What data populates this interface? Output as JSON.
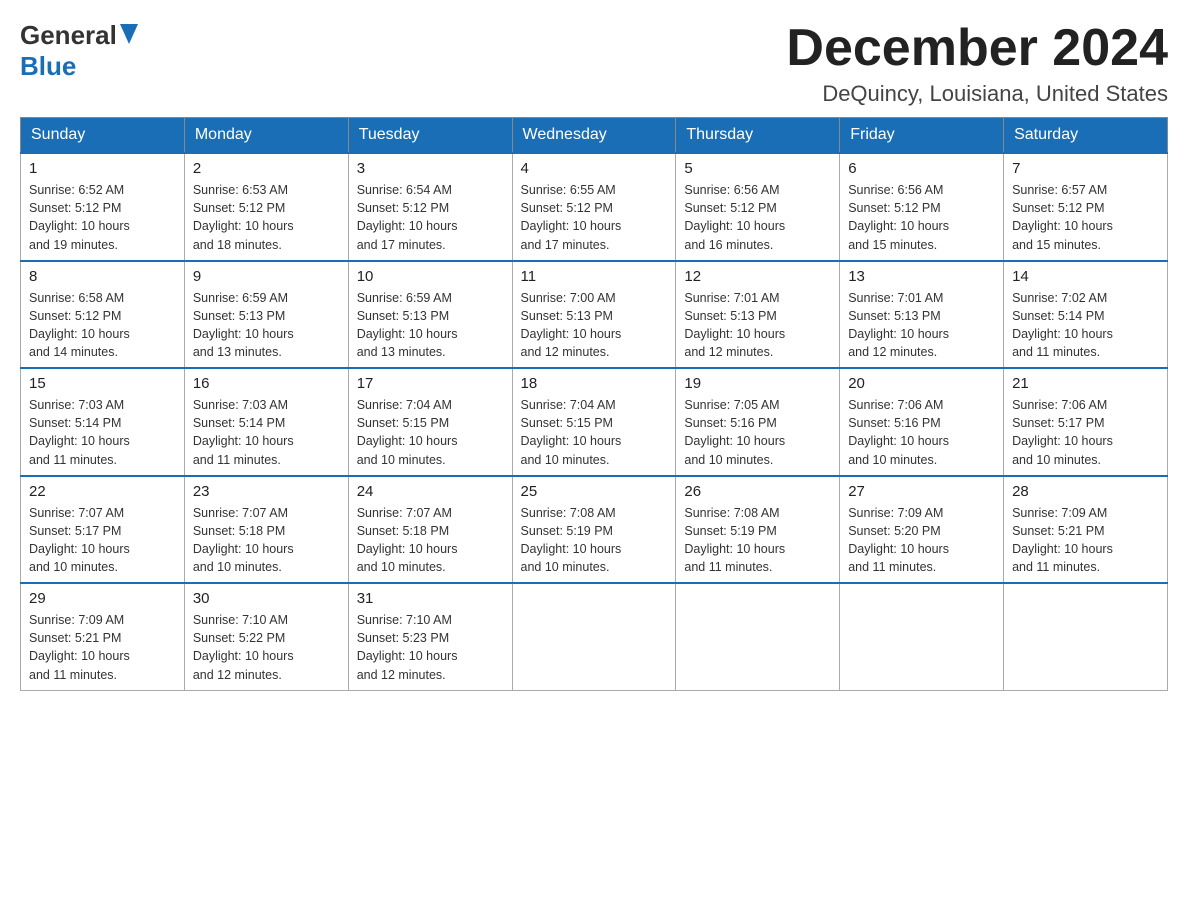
{
  "header": {
    "logo_line1": "General",
    "logo_line2": "Blue",
    "month_title": "December 2024",
    "location": "DeQuincy, Louisiana, United States"
  },
  "days_of_week": [
    "Sunday",
    "Monday",
    "Tuesday",
    "Wednesday",
    "Thursday",
    "Friday",
    "Saturday"
  ],
  "weeks": [
    [
      {
        "day": "1",
        "sunrise": "6:52 AM",
        "sunset": "5:12 PM",
        "daylight": "10 hours and 19 minutes."
      },
      {
        "day": "2",
        "sunrise": "6:53 AM",
        "sunset": "5:12 PM",
        "daylight": "10 hours and 18 minutes."
      },
      {
        "day": "3",
        "sunrise": "6:54 AM",
        "sunset": "5:12 PM",
        "daylight": "10 hours and 17 minutes."
      },
      {
        "day": "4",
        "sunrise": "6:55 AM",
        "sunset": "5:12 PM",
        "daylight": "10 hours and 17 minutes."
      },
      {
        "day": "5",
        "sunrise": "6:56 AM",
        "sunset": "5:12 PM",
        "daylight": "10 hours and 16 minutes."
      },
      {
        "day": "6",
        "sunrise": "6:56 AM",
        "sunset": "5:12 PM",
        "daylight": "10 hours and 15 minutes."
      },
      {
        "day": "7",
        "sunrise": "6:57 AM",
        "sunset": "5:12 PM",
        "daylight": "10 hours and 15 minutes."
      }
    ],
    [
      {
        "day": "8",
        "sunrise": "6:58 AM",
        "sunset": "5:12 PM",
        "daylight": "10 hours and 14 minutes."
      },
      {
        "day": "9",
        "sunrise": "6:59 AM",
        "sunset": "5:13 PM",
        "daylight": "10 hours and 13 minutes."
      },
      {
        "day": "10",
        "sunrise": "6:59 AM",
        "sunset": "5:13 PM",
        "daylight": "10 hours and 13 minutes."
      },
      {
        "day": "11",
        "sunrise": "7:00 AM",
        "sunset": "5:13 PM",
        "daylight": "10 hours and 12 minutes."
      },
      {
        "day": "12",
        "sunrise": "7:01 AM",
        "sunset": "5:13 PM",
        "daylight": "10 hours and 12 minutes."
      },
      {
        "day": "13",
        "sunrise": "7:01 AM",
        "sunset": "5:13 PM",
        "daylight": "10 hours and 12 minutes."
      },
      {
        "day": "14",
        "sunrise": "7:02 AM",
        "sunset": "5:14 PM",
        "daylight": "10 hours and 11 minutes."
      }
    ],
    [
      {
        "day": "15",
        "sunrise": "7:03 AM",
        "sunset": "5:14 PM",
        "daylight": "10 hours and 11 minutes."
      },
      {
        "day": "16",
        "sunrise": "7:03 AM",
        "sunset": "5:14 PM",
        "daylight": "10 hours and 11 minutes."
      },
      {
        "day": "17",
        "sunrise": "7:04 AM",
        "sunset": "5:15 PM",
        "daylight": "10 hours and 10 minutes."
      },
      {
        "day": "18",
        "sunrise": "7:04 AM",
        "sunset": "5:15 PM",
        "daylight": "10 hours and 10 minutes."
      },
      {
        "day": "19",
        "sunrise": "7:05 AM",
        "sunset": "5:16 PM",
        "daylight": "10 hours and 10 minutes."
      },
      {
        "day": "20",
        "sunrise": "7:06 AM",
        "sunset": "5:16 PM",
        "daylight": "10 hours and 10 minutes."
      },
      {
        "day": "21",
        "sunrise": "7:06 AM",
        "sunset": "5:17 PM",
        "daylight": "10 hours and 10 minutes."
      }
    ],
    [
      {
        "day": "22",
        "sunrise": "7:07 AM",
        "sunset": "5:17 PM",
        "daylight": "10 hours and 10 minutes."
      },
      {
        "day": "23",
        "sunrise": "7:07 AM",
        "sunset": "5:18 PM",
        "daylight": "10 hours and 10 minutes."
      },
      {
        "day": "24",
        "sunrise": "7:07 AM",
        "sunset": "5:18 PM",
        "daylight": "10 hours and 10 minutes."
      },
      {
        "day": "25",
        "sunrise": "7:08 AM",
        "sunset": "5:19 PM",
        "daylight": "10 hours and 10 minutes."
      },
      {
        "day": "26",
        "sunrise": "7:08 AM",
        "sunset": "5:19 PM",
        "daylight": "10 hours and 11 minutes."
      },
      {
        "day": "27",
        "sunrise": "7:09 AM",
        "sunset": "5:20 PM",
        "daylight": "10 hours and 11 minutes."
      },
      {
        "day": "28",
        "sunrise": "7:09 AM",
        "sunset": "5:21 PM",
        "daylight": "10 hours and 11 minutes."
      }
    ],
    [
      {
        "day": "29",
        "sunrise": "7:09 AM",
        "sunset": "5:21 PM",
        "daylight": "10 hours and 11 minutes."
      },
      {
        "day": "30",
        "sunrise": "7:10 AM",
        "sunset": "5:22 PM",
        "daylight": "10 hours and 12 minutes."
      },
      {
        "day": "31",
        "sunrise": "7:10 AM",
        "sunset": "5:23 PM",
        "daylight": "10 hours and 12 minutes."
      },
      null,
      null,
      null,
      null
    ]
  ]
}
